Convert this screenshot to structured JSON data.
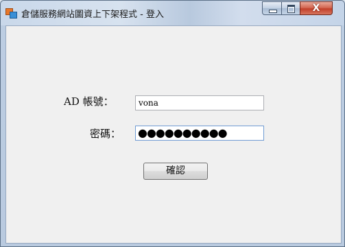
{
  "window": {
    "title": "倉儲服務網站圖資上下架程式 - 登入",
    "close_glyph": "X"
  },
  "form": {
    "ad_label": "AD 帳號：",
    "ad_value": "vona",
    "password_label": "密碼：",
    "password_value": "●●●●●●●●●●",
    "confirm_label": "確認"
  },
  "icons": {
    "app": "app-window-icon",
    "minimize": "minimize-icon",
    "maximize": "maximize-icon",
    "close": "close-icon"
  },
  "colors": {
    "close_button": "#c2402a",
    "client_background": "#f0f0f0",
    "focused_border": "#6f9bd3"
  }
}
